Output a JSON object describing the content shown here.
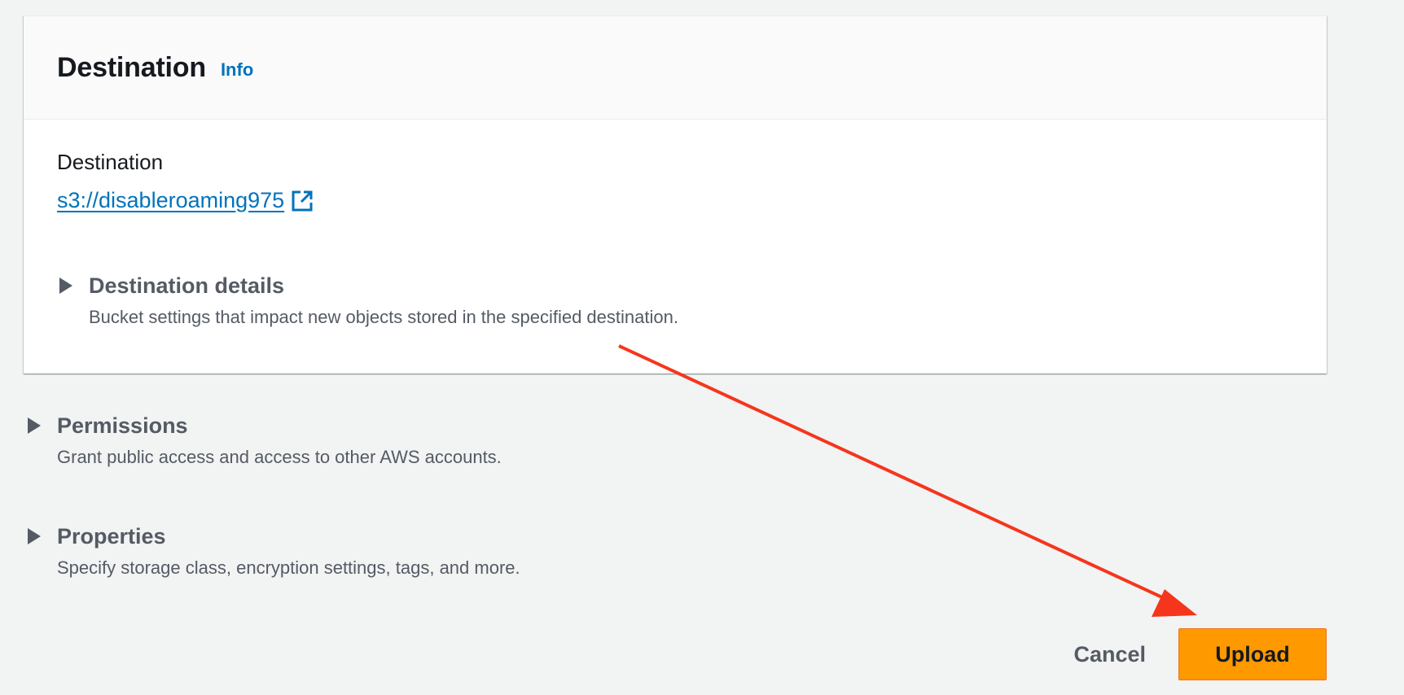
{
  "destination_panel": {
    "title": "Destination",
    "info_label": "Info",
    "field_label": "Destination",
    "bucket_link": "s3://disableroaming975",
    "details": {
      "title": "Destination details",
      "description": "Bucket settings that impact new objects stored in the specified destination."
    }
  },
  "permissions": {
    "title": "Permissions",
    "description": "Grant public access and access to other AWS accounts."
  },
  "properties": {
    "title": "Properties",
    "description": "Specify storage class, encryption settings, tags, and more."
  },
  "actions": {
    "cancel_label": "Cancel",
    "upload_label": "Upload"
  },
  "colors": {
    "link": "#0073bb",
    "primary_button": "#ff9900",
    "annotation_arrow": "#f5361c"
  },
  "icons": {
    "external_link": "external-link-icon",
    "expand_caret": "caret-right-icon"
  }
}
